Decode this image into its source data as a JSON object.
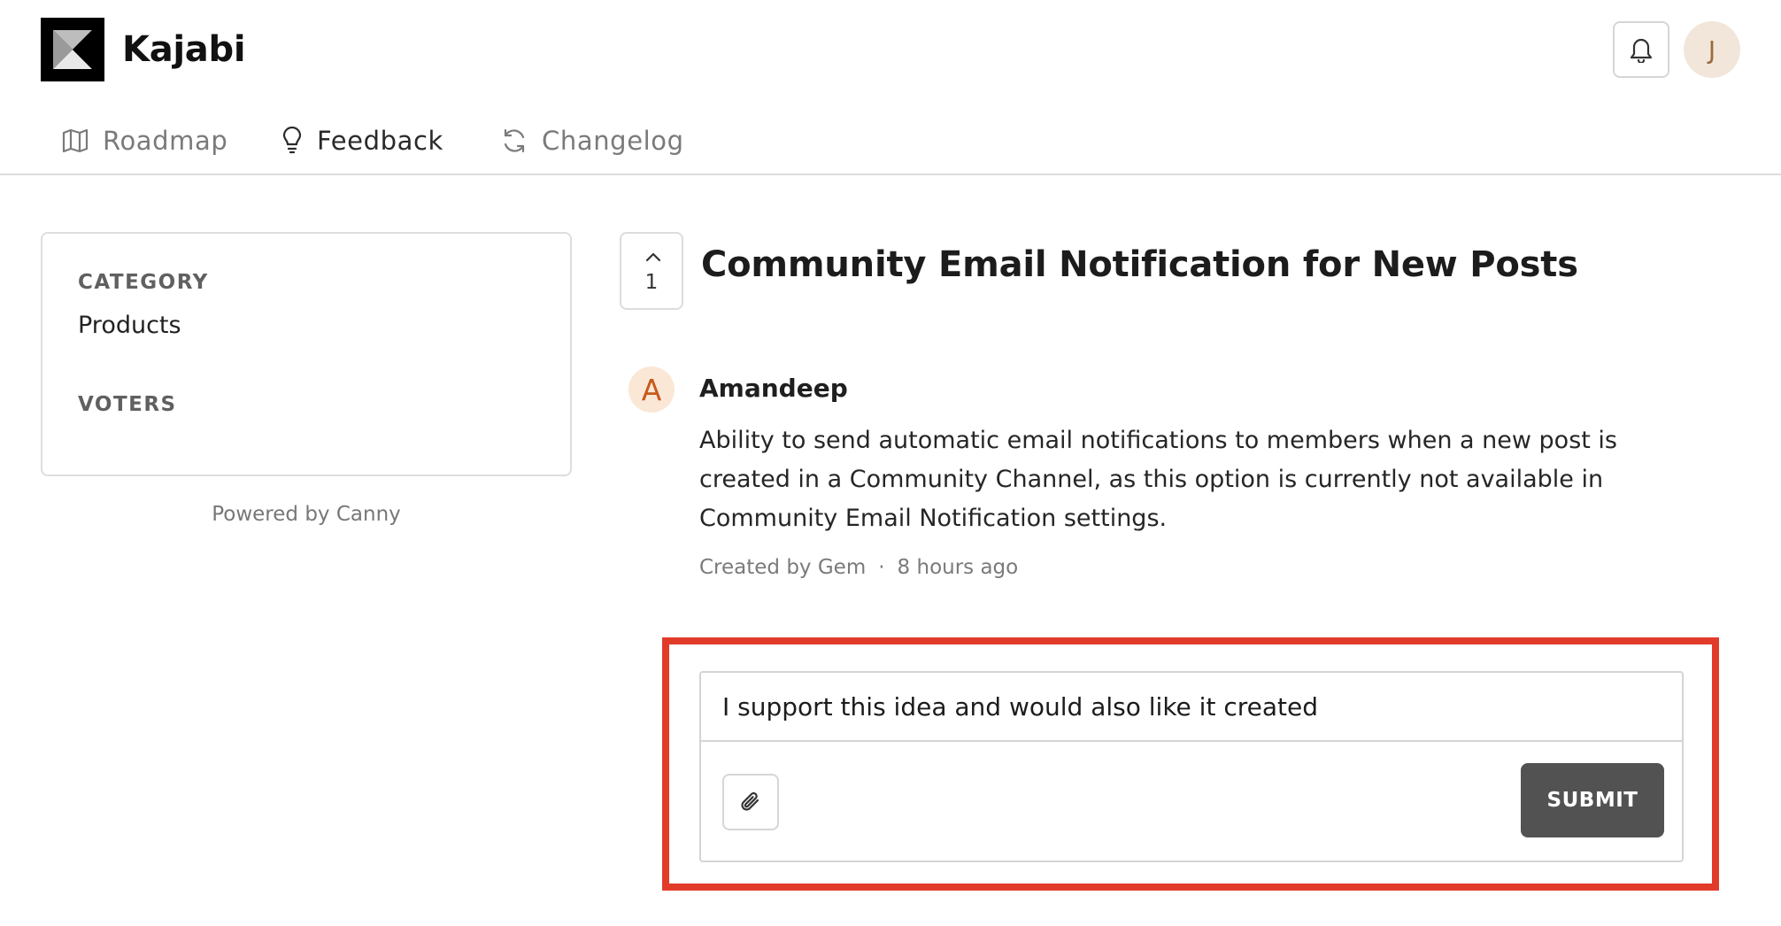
{
  "header": {
    "brand": "Kajabi",
    "logo_icon": "kajabi-logo",
    "bell_icon": "bell-icon",
    "user_initial": "J"
  },
  "nav": {
    "items": [
      {
        "label": "Roadmap",
        "icon": "map-icon",
        "active": false
      },
      {
        "label": "Feedback",
        "icon": "lightbulb-icon",
        "active": true
      },
      {
        "label": "Changelog",
        "icon": "refresh-icon",
        "active": false
      }
    ]
  },
  "sidebar": {
    "category_label": "CATEGORY",
    "category_value": "Products",
    "voters_label": "VOTERS",
    "powered_by": "Powered by Canny"
  },
  "post": {
    "vote_count": "1",
    "title": "Community Email Notification for New Posts",
    "author_initial": "A",
    "author_name": "Amandeep",
    "body": "Ability to send automatic email notifications to members when a new post is created in a Community Channel, as this option is currently not available in Community Email Notification settings.",
    "created_by": "Created by Gem",
    "separator": "·",
    "time_ago": "8 hours ago"
  },
  "composer": {
    "comment_value": "I support this idea and would also like it created",
    "attach_icon": "paperclip-icon",
    "submit_label": "SUBMIT"
  },
  "colors": {
    "highlight": "#e23b29",
    "submit_bg": "#525252",
    "author_avatar_text": "#c65a1e"
  }
}
